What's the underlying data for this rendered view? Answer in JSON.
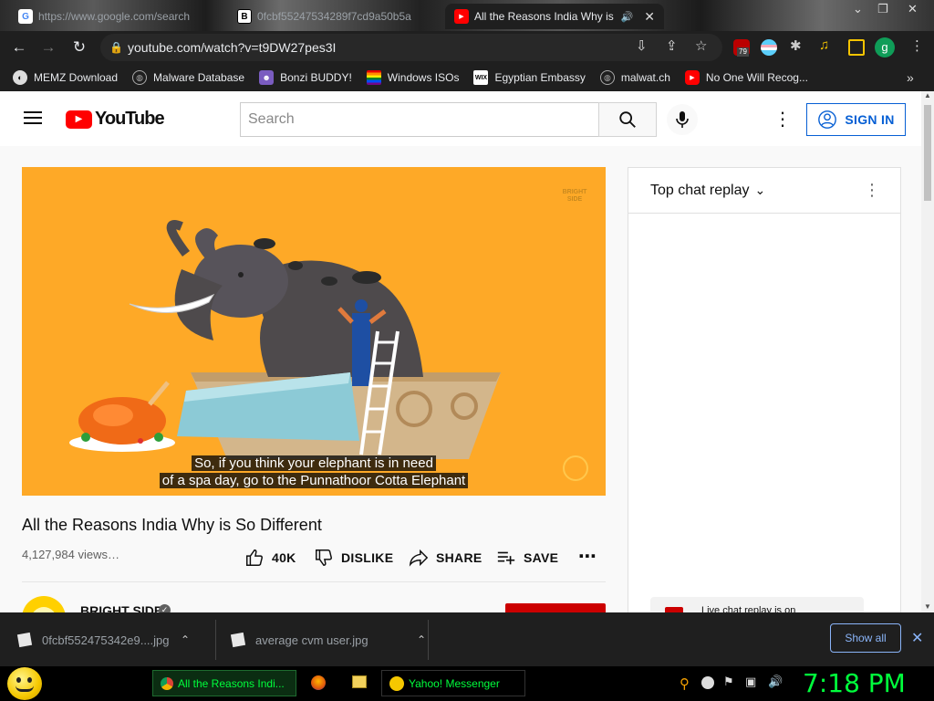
{
  "browser": {
    "tabs": [
      {
        "label": "https://www.google.com/search",
        "icon": "google-icon",
        "active": false
      },
      {
        "label": "0fcbf55247534289f7cd9a50b5a",
        "icon": "b-icon",
        "active": false
      },
      {
        "label": "All the Reasons India Why is",
        "icon": "youtube-icon",
        "active": true
      }
    ],
    "url": "youtube.com/watch?v=t9DW27pes3I",
    "extension_badge": "79",
    "profile_initial": "g",
    "bookmarks": [
      {
        "label": "MEMZ Download",
        "icon": "memz-icon"
      },
      {
        "label": "Malware Database",
        "icon": "globe-icon"
      },
      {
        "label": "Bonzi BUDDY!",
        "icon": "bonzi-icon"
      },
      {
        "label": "Windows ISOs",
        "icon": "windows-icon"
      },
      {
        "label": "Egyptian Embassy",
        "icon": "wix-icon"
      },
      {
        "label": "malwat.ch",
        "icon": "globe-icon"
      },
      {
        "label": "No One Will Recog...",
        "icon": "youtube-icon"
      }
    ],
    "more_bookmarks": "»"
  },
  "youtube": {
    "logo_text": "YouTube",
    "search_placeholder": "Search",
    "sign_in_label": "SIGN IN",
    "video": {
      "watermark": "BRIGHT SIDE",
      "subtitle_line1": "So, if you think your elephant is in need",
      "subtitle_line2": "of a spa day, go to the Punnathoor Cotta Elephant"
    },
    "title": "All the Reasons India Why is So Different",
    "views": "4,127,984 views…",
    "actions": {
      "like": "40K",
      "dislike": "DISLIKE",
      "share": "SHARE",
      "save": "SAVE"
    },
    "channel": "BRIGHT SIDE",
    "chat": {
      "header": "Top chat replay",
      "notice": "Live chat replay is on"
    }
  },
  "downloads": {
    "items": [
      {
        "name": "0fcbf552475342e9....jpg"
      },
      {
        "name": "average cvm user.jpg"
      }
    ],
    "show_all": "Show all"
  },
  "taskbar": {
    "tasks": [
      {
        "label": "All the Reasons Indi...",
        "icon": "chrome-icon"
      },
      {
        "label": "Yahoo! Messenger",
        "icon": "yahoo-icon"
      }
    ],
    "clock": "7:18 PM"
  },
  "colors": {
    "youtube_red": "#ff0000",
    "video_bg": "#fea927",
    "link_blue": "#065fd4",
    "taskbar_green": "#00ff3c"
  }
}
